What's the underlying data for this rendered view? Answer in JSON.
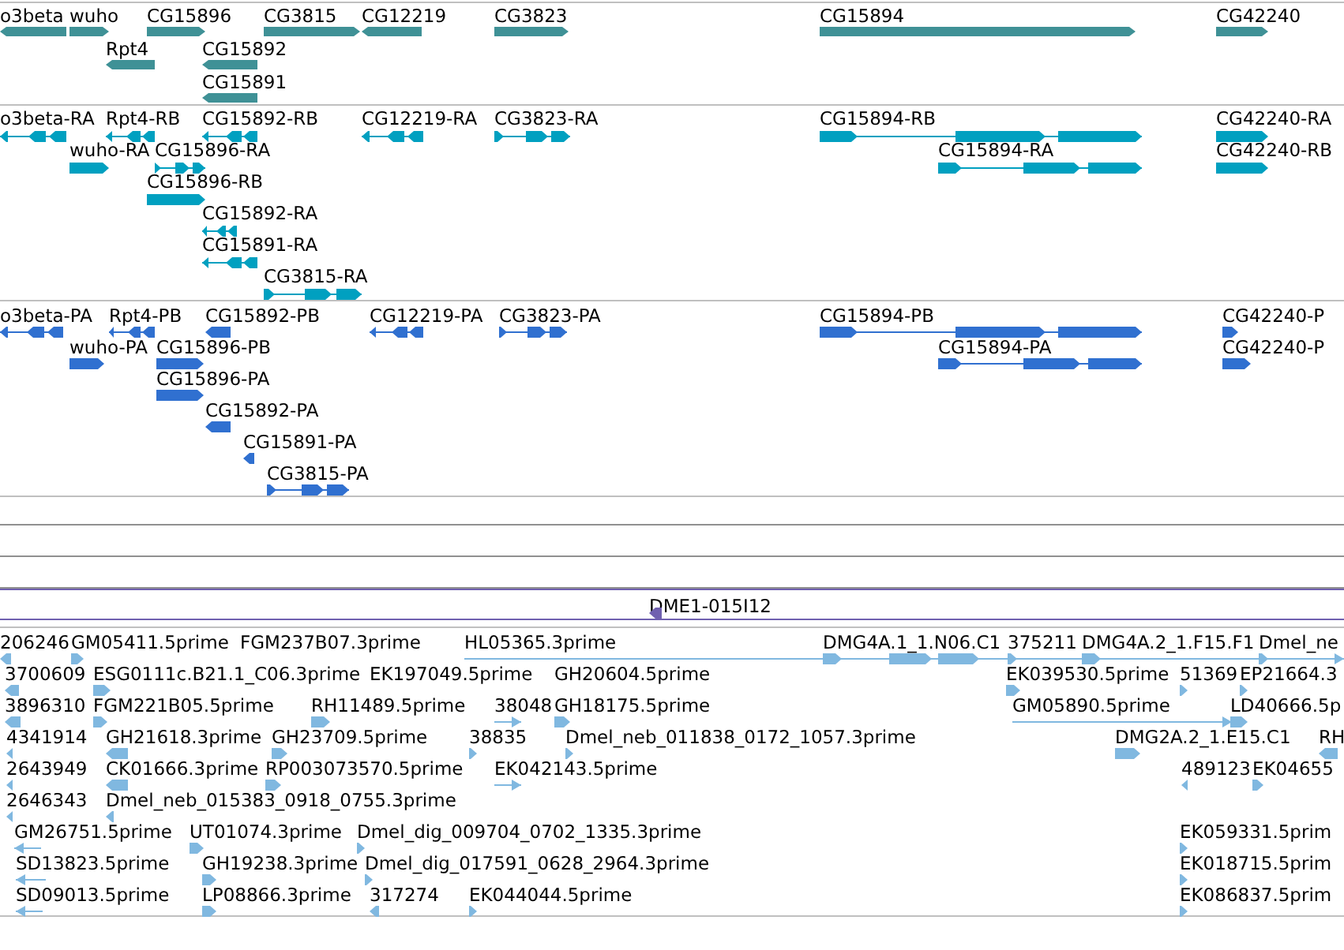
{
  "tracks": [
    {
      "color": "#3f9196",
      "rows": [
        {
          "features": [
            {
              "label": "o3beta",
              "reverse": true,
              "kind": "block"
            },
            {
              "label": "wuho",
              "reverse": false,
              "kind": "block"
            },
            {
              "label": "CG15896",
              "reverse": false,
              "kind": "block"
            },
            {
              "label": "CG3815",
              "reverse": false,
              "kind": "block"
            },
            {
              "label": "CG12219",
              "reverse": true,
              "kind": "block"
            },
            {
              "label": "CG3823",
              "reverse": false,
              "kind": "block"
            },
            {
              "label": "CG15894",
              "reverse": false,
              "kind": "block"
            },
            {
              "label": "CG42240",
              "reverse": false,
              "kind": "block"
            }
          ]
        },
        {
          "features": [
            {
              "label": "Rpt4",
              "reverse": true,
              "kind": "block"
            },
            {
              "label": "CG15892",
              "reverse": true,
              "kind": "block"
            }
          ]
        },
        {
          "features": [
            {
              "label": "CG15891",
              "reverse": true,
              "kind": "block"
            }
          ]
        }
      ]
    },
    {
      "color": "#00a0c0",
      "rows": [
        {
          "features": [
            {
              "label": "o3beta-RA",
              "reverse": true,
              "kind": "spliced"
            },
            {
              "label": "Rpt4-RB",
              "reverse": true,
              "kind": "spliced"
            },
            {
              "label": "CG15892-RB",
              "reverse": true,
              "kind": "spliced"
            },
            {
              "label": "CG12219-RA",
              "reverse": true,
              "kind": "spliced"
            },
            {
              "label": "CG3823-RA",
              "reverse": false,
              "kind": "spliced"
            },
            {
              "label": "CG15894-RB",
              "reverse": false,
              "kind": "spliced"
            },
            {
              "label": "CG42240-RA",
              "reverse": false,
              "kind": "block"
            }
          ]
        },
        {
          "features": [
            {
              "label": "wuho-RA",
              "reverse": false,
              "kind": "block"
            },
            {
              "label": "CG15896-RA",
              "reverse": false,
              "kind": "spliced"
            },
            {
              "label": "CG15894-RA",
              "reverse": false,
              "kind": "spliced"
            },
            {
              "label": "CG42240-RB",
              "reverse": false,
              "kind": "block"
            }
          ]
        },
        {
          "features": [
            {
              "label": "CG15896-RB",
              "reverse": false,
              "kind": "block"
            }
          ]
        },
        {
          "features": [
            {
              "label": "CG15892-RA",
              "reverse": true,
              "kind": "spliced"
            }
          ]
        },
        {
          "features": [
            {
              "label": "CG15891-RA",
              "reverse": true,
              "kind": "spliced"
            }
          ]
        },
        {
          "features": [
            {
              "label": "CG3815-RA",
              "reverse": false,
              "kind": "spliced"
            }
          ]
        }
      ]
    },
    {
      "color": "#3070d0",
      "rows": [
        {
          "features": [
            {
              "label": "o3beta-PA",
              "reverse": true,
              "kind": "spliced"
            },
            {
              "label": "Rpt4-PB",
              "reverse": true,
              "kind": "spliced"
            },
            {
              "label": "CG15892-PB",
              "reverse": true,
              "kind": "block"
            },
            {
              "label": "CG12219-PA",
              "reverse": true,
              "kind": "spliced"
            },
            {
              "label": "CG3823-PA",
              "reverse": false,
              "kind": "spliced"
            },
            {
              "label": "CG15894-PB",
              "reverse": false,
              "kind": "spliced"
            },
            {
              "label": "CG42240-P",
              "reverse": false,
              "kind": "block"
            }
          ]
        },
        {
          "features": [
            {
              "label": "wuho-PA",
              "reverse": false,
              "kind": "block"
            },
            {
              "label": "CG15896-PB",
              "reverse": false,
              "kind": "block"
            },
            {
              "label": "CG15894-PA",
              "reverse": false,
              "kind": "spliced"
            },
            {
              "label": "CG42240-P",
              "reverse": false,
              "kind": "block"
            }
          ]
        },
        {
          "features": [
            {
              "label": "CG15896-PA",
              "reverse": false,
              "kind": "block"
            }
          ]
        },
        {
          "features": [
            {
              "label": "CG15892-PA",
              "reverse": true,
              "kind": "block"
            }
          ]
        },
        {
          "features": [
            {
              "label": "CG15891-PA",
              "reverse": true,
              "kind": "block"
            }
          ]
        },
        {
          "features": [
            {
              "label": "CG3815-PA",
              "reverse": false,
              "kind": "spliced"
            }
          ]
        }
      ]
    },
    {
      "color": "#7060b0",
      "rows": [
        {
          "features": [
            {
              "label": "DME1-015I12",
              "reverse": true,
              "kind": "block"
            }
          ]
        }
      ]
    },
    {
      "color": "#80b8e0",
      "rows": [
        {
          "features": [
            {
              "label": "206246",
              "reverse": true,
              "kind": "block"
            },
            {
              "label": "GM05411.5prime",
              "reverse": false,
              "kind": "block"
            },
            {
              "label": "FGM237B07.3prime"
            },
            {
              "label": "HL05365.3prime",
              "reverse": false,
              "kind": "line"
            },
            {
              "label": "DMG4A.1_1.N06.C1",
              "reverse": false,
              "kind": "spliced"
            },
            {
              "label": "375211",
              "reverse": false,
              "kind": "block"
            },
            {
              "label": "DMG4A.2_1.F15.F1",
              "reverse": false,
              "kind": "block"
            },
            {
              "label": "Dmel_ne",
              "reverse": false,
              "kind": "block"
            }
          ]
        },
        {
          "features": [
            {
              "label": "3700609",
              "reverse": true,
              "kind": "block"
            },
            {
              "label": "ESG0111c.B21.1_C06.3prime",
              "reverse": false,
              "kind": "block"
            },
            {
              "label": "EK197049.5prime"
            },
            {
              "label": "GH20604.5prime"
            },
            {
              "label": "EK039530.5prime",
              "reverse": false,
              "kind": "block"
            },
            {
              "label": "51369",
              "reverse": false,
              "kind": "block"
            },
            {
              "label": "EP21664.3",
              "reverse": false,
              "kind": "block"
            }
          ]
        },
        {
          "features": [
            {
              "label": "3896310",
              "reverse": true,
              "kind": "block"
            },
            {
              "label": "FGM221B05.5prime",
              "reverse": false,
              "kind": "block"
            },
            {
              "label": "RH11489.5prime",
              "reverse": false,
              "kind": "block"
            },
            {
              "label": "38048",
              "reverse": false,
              "kind": "line"
            },
            {
              "label": "GH18175.5prime",
              "reverse": false,
              "kind": "block"
            },
            {
              "label": "GM05890.5prime",
              "reverse": false,
              "kind": "line"
            },
            {
              "label": "LD40666.5p",
              "reverse": false,
              "kind": "block"
            }
          ]
        },
        {
          "features": [
            {
              "label": "4341914",
              "reverse": true,
              "kind": "block"
            },
            {
              "label": "GH21618.3prime",
              "reverse": true,
              "kind": "block"
            },
            {
              "label": "GH23709.5prime",
              "reverse": false,
              "kind": "block"
            },
            {
              "label": "38835",
              "reverse": false,
              "kind": "block"
            },
            {
              "label": "Dmel_neb_011838_0172_1057.3prime",
              "reverse": false,
              "kind": "block"
            },
            {
              "label": "DMG2A.2_1.E15.C1",
              "reverse": false,
              "kind": "block"
            },
            {
              "label": "RH",
              "reverse": true,
              "kind": "block"
            }
          ]
        },
        {
          "features": [
            {
              "label": "2643949",
              "reverse": true,
              "kind": "block"
            },
            {
              "label": "CK01666.3prime",
              "reverse": true,
              "kind": "block"
            },
            {
              "label": "RP003073570.5prime",
              "reverse": false,
              "kind": "block"
            },
            {
              "label": "EK042143.5prime",
              "reverse": false,
              "kind": "line"
            },
            {
              "label": "489123",
              "reverse": true,
              "kind": "block"
            },
            {
              "label": "EK04655",
              "reverse": false,
              "kind": "block"
            }
          ]
        },
        {
          "features": [
            {
              "label": "2646343",
              "reverse": true,
              "kind": "block"
            },
            {
              "label": "Dmel_neb_015383_0918_0755.3prime",
              "reverse": true,
              "kind": "block"
            }
          ]
        },
        {
          "features": [
            {
              "label": "GM26751.5prime",
              "reverse": true,
              "kind": "line"
            },
            {
              "label": "UT01074.3prime",
              "reverse": false,
              "kind": "block"
            },
            {
              "label": "Dmel_dig_009704_0702_1335.3prime",
              "reverse": false,
              "kind": "block"
            },
            {
              "label": "EK059331.5prim",
              "reverse": false,
              "kind": "block"
            }
          ]
        },
        {
          "features": [
            {
              "label": "SD13823.5prime",
              "reverse": true,
              "kind": "line"
            },
            {
              "label": "GH19238.3prime",
              "reverse": false,
              "kind": "block"
            },
            {
              "label": "Dmel_dig_017591_0628_2964.3prime",
              "reverse": false,
              "kind": "block"
            },
            {
              "label": "EK018715.5prim",
              "reverse": false,
              "kind": "block"
            }
          ]
        },
        {
          "features": [
            {
              "label": "SD09013.5prime",
              "reverse": true,
              "kind": "line"
            },
            {
              "label": "LP08866.3prime",
              "reverse": false,
              "kind": "block"
            },
            {
              "label": "317274",
              "reverse": true,
              "kind": "block"
            },
            {
              "label": "EK044044.5prime",
              "reverse": false,
              "kind": "block"
            },
            {
              "label": "EK086837.5prim",
              "reverse": false,
              "kind": "block"
            }
          ]
        }
      ]
    }
  ]
}
